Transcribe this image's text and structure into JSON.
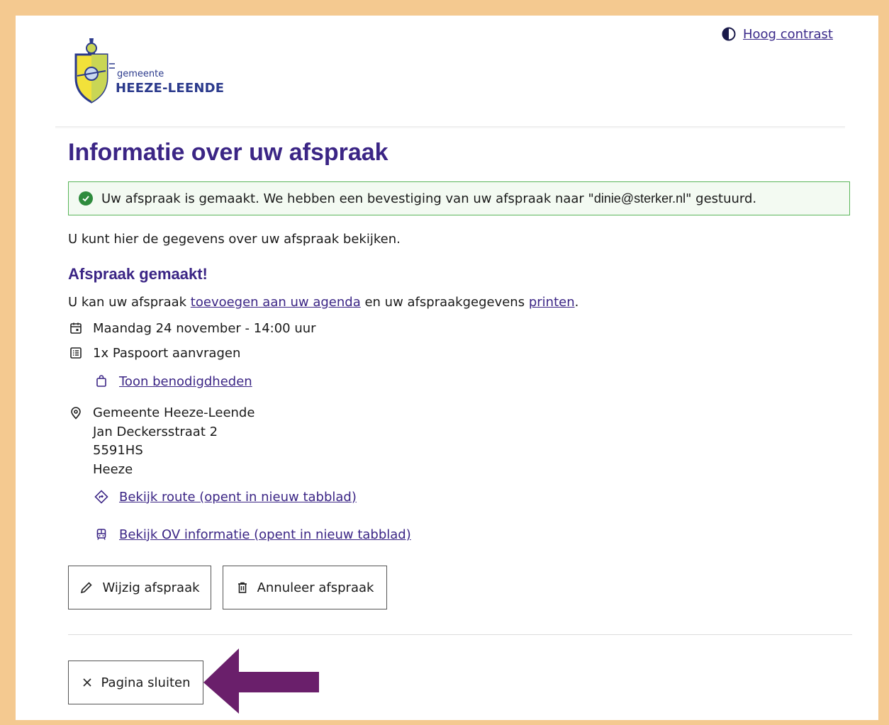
{
  "header": {
    "logo_small": "gemeente",
    "logo_big": "HEEZE-LEENDE",
    "contrast_label": "Hoog contrast"
  },
  "page_title": "Informatie over uw afspraak",
  "alert": {
    "text_before": "Uw afspraak is gemaakt. We hebben een bevestiging van uw afspraak naar \"",
    "email": "dinie@sterker.nl",
    "text_after": "\" gestuurd."
  },
  "intro": "U kunt hier de gegevens over uw afspraak bekijken.",
  "section_title": "Afspraak gemaakt!",
  "actions_line": {
    "prefix": "U kan uw afspraak ",
    "link_agenda": "toevoegen aan uw agenda",
    "middle": " en uw afspraakgegevens ",
    "link_print": "printen",
    "suffix": "."
  },
  "appointment": {
    "date": "Maandag 24 november - 14:00 uur",
    "product": "1x Paspoort aanvragen",
    "requirements_link": "Toon benodigdheden",
    "address_lines": [
      "Gemeente Heeze-Leende",
      "Jan Deckersstraat 2",
      "5591HS",
      "Heeze"
    ],
    "route_link": "Bekijk route (opent in nieuw tabblad)",
    "ov_link": "Bekijk OV informatie (opent in nieuw tabblad)"
  },
  "buttons": {
    "edit": "Wijzig afspraak",
    "cancel": "Annuleer afspraak",
    "close": "Pagina sluiten"
  },
  "colors": {
    "frame": "#f4c990",
    "heading": "#3b2585",
    "success_border": "#5ab55a",
    "success_icon": "#2e8b3d",
    "arrow": "#6a1f6b"
  },
  "icons": [
    "contrast-icon",
    "check-circle-icon",
    "calendar-icon",
    "list-icon",
    "bag-icon",
    "map-pin-icon",
    "route-icon",
    "bus-icon",
    "pencil-icon",
    "trash-icon",
    "close-icon"
  ]
}
